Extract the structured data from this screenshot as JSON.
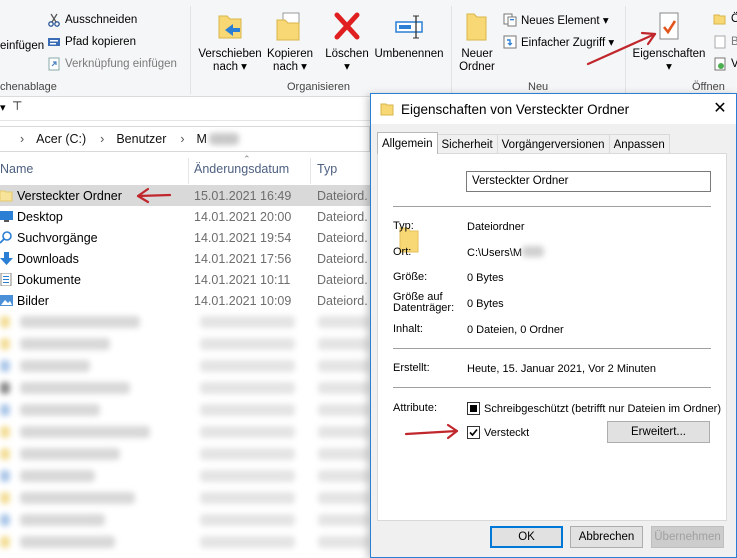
{
  "ribbon": {
    "clipboard": {
      "paste_label": "einfügen",
      "cut_label": "Ausschneiden",
      "copy_path_label": "Pfad kopieren",
      "paste_shortcut_label": "Verknüpfung einfügen",
      "group_label": "chenablage"
    },
    "organize": {
      "move_label": "Verschieben",
      "move_sub": "nach ▾",
      "copy_label": "Kopieren",
      "copy_sub": "nach ▾",
      "delete_label": "Löschen",
      "delete_sub": "▾",
      "rename_label": "Umbenennen",
      "group_label": "Organisieren"
    },
    "new": {
      "new_folder_label1": "Neuer",
      "new_folder_label2": "Ordner",
      "new_item_label": "Neues Element ▾",
      "easy_access_label": "Einfacher Zugriff ▾",
      "group_label": "Neu"
    },
    "open": {
      "properties_label": "Eigenschaften",
      "properties_sub": "▾",
      "group_label": "Öffnen",
      "cut_letters": [
        "Ö",
        "B",
        "V"
      ]
    }
  },
  "address": {
    "segments": [
      "Acer (C:)",
      "Benutzer",
      "M"
    ]
  },
  "columns": {
    "name": "Name",
    "date": "Änderungsdatum",
    "type": "Typ"
  },
  "files": [
    {
      "name": "Versteckter Ordner",
      "date": "15.01.2021 16:49",
      "type": "Dateiord."
    },
    {
      "name": "Desktop",
      "date": "14.01.2021 20:00",
      "type": "Dateiord."
    },
    {
      "name": "Suchvorgänge",
      "date": "14.01.2021 19:54",
      "type": "Dateiord."
    },
    {
      "name": "Downloads",
      "date": "14.01.2021 17:56",
      "type": "Dateiord."
    },
    {
      "name": "Dokumente",
      "date": "14.01.2021 10:11",
      "type": "Dateiord."
    },
    {
      "name": "Bilder",
      "date": "14.01.2021 10:09",
      "type": "Dateiord."
    }
  ],
  "dialog": {
    "title": "Eigenschaften von Versteckter Ordner",
    "close": "✕",
    "tabs": [
      "Allgemein",
      "Sicherheit",
      "Vorgängerversionen",
      "Anpassen"
    ],
    "folder_name": "Versteckter Ordner",
    "type_label": "Typ:",
    "type_value": "Dateiordner",
    "location_label": "Ort:",
    "location_value": "C:\\Users\\M",
    "size_label": "Größe:",
    "size_value": "0 Bytes",
    "disk_size_label1": "Größe auf",
    "disk_size_label2": "Datenträger:",
    "disk_size_value": "0 Bytes",
    "contents_label": "Inhalt:",
    "contents_value": "0 Dateien, 0 Ordner",
    "created_label": "Erstellt:",
    "created_value": "Heute, 15. Januar 2021, Vor 2 Minuten",
    "attributes_label": "Attribute:",
    "readonly_label": "Schreibgeschützt (betrifft nur Dateien im Ordner)",
    "hidden_label": "Versteckt",
    "advanced_label": "Erweitert...",
    "ok_label": "OK",
    "cancel_label": "Abbrechen",
    "apply_label": "Übernehmen"
  },
  "colors": {
    "annotation_arrow": "#c0272d",
    "dialog_border": "#2a7fd4",
    "selection": "#d9d9d9",
    "folder": "#f8d775"
  }
}
